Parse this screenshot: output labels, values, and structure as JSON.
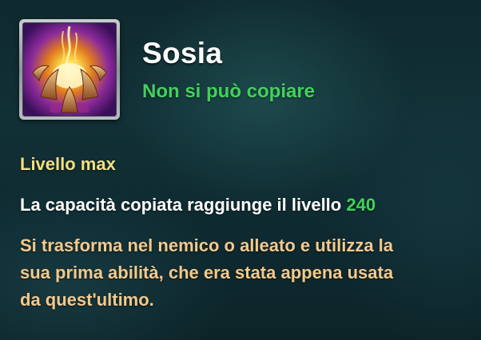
{
  "skill": {
    "icon": "golden-claw-burst-icon",
    "name": "Sosia",
    "copy_status": "Non si può copiare"
  },
  "level": {
    "heading": "Livello max",
    "text": "La capacità copiata raggiunge il livello",
    "value": "240"
  },
  "description": {
    "lines": [
      "Si trasforma nel nemico o alleato e utilizza la",
      "sua prima abilità, che era stata appena usata",
      "da quest'ultimo."
    ]
  },
  "colors": {
    "title": "#ffffff",
    "status_green": "#41d25b",
    "heading_yellow": "#f2df82",
    "description_orange": "#f5c98b",
    "background": "#10292d"
  }
}
